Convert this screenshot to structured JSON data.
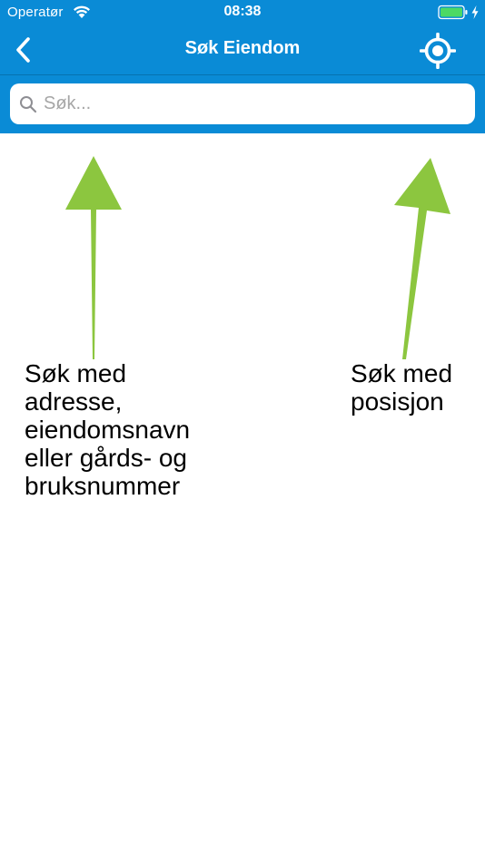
{
  "status_bar": {
    "carrier": "Operatør",
    "time": "08:38"
  },
  "nav_bar": {
    "title": "Søk Eiendom",
    "back_icon": "chevron-left-icon",
    "locate_icon": "crosshair-location-icon"
  },
  "search": {
    "placeholder": "Søk...",
    "value": ""
  },
  "hints": {
    "left": "Søk med\nadresse,\neiendomsnavn\neller gårds- og\nbruksnummer",
    "right": "Søk med\nposisjon"
  },
  "colors": {
    "header_blue": "#0A8BD6",
    "arrow_green": "#8CC63F",
    "battery_green": "#4CD964"
  }
}
